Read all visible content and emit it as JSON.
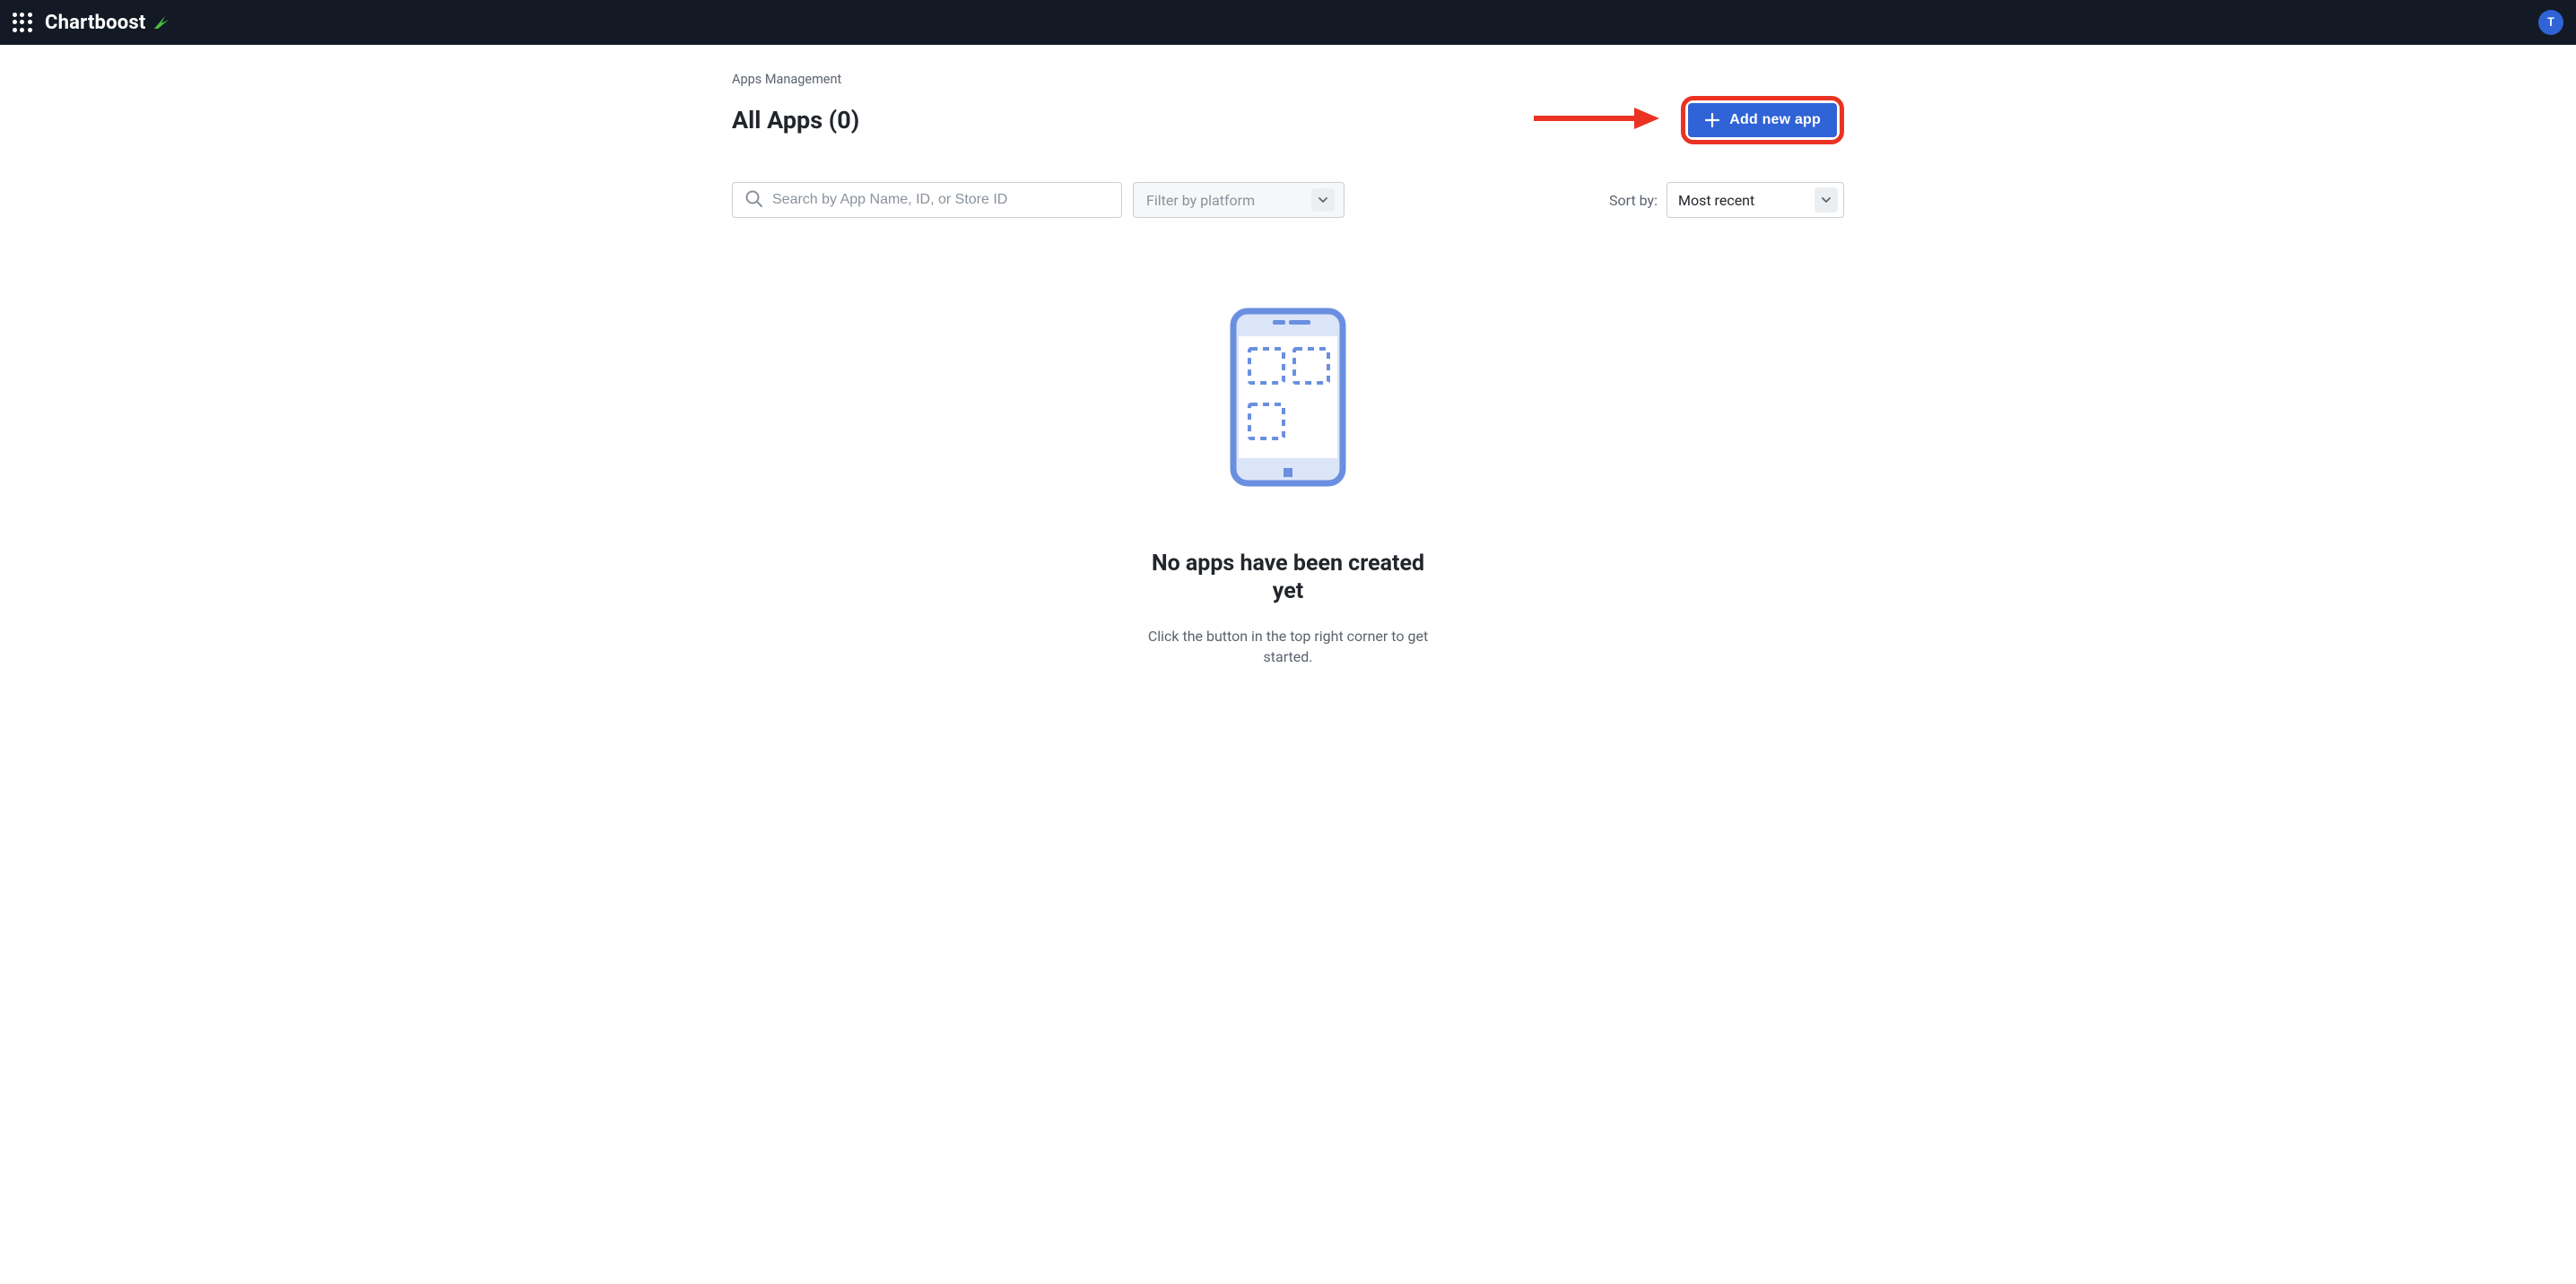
{
  "header": {
    "brand": "Chartboost",
    "avatar_initial": "T"
  },
  "breadcrumb": "Apps Management",
  "page_title": "All Apps (0)",
  "add_button_label": "Add new app",
  "search": {
    "placeholder": "Search by App Name, ID, or Store ID",
    "value": ""
  },
  "platform_filter": {
    "placeholder": "Filter by platform"
  },
  "sort": {
    "label": "Sort by:",
    "selected": "Most recent"
  },
  "empty_state": {
    "title": "No apps have been created yet",
    "subtitle": "Click the button in the top right corner to get started."
  },
  "colors": {
    "accent": "#2f63d6",
    "annotation": "#ea3323",
    "topbar": "#131a25"
  }
}
